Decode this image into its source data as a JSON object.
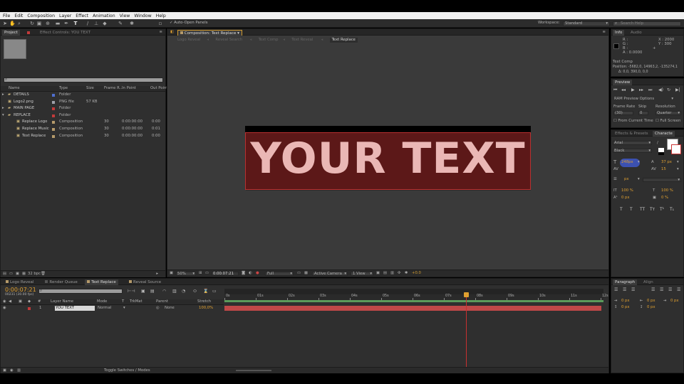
{
  "menu": [
    "File",
    "Edit",
    "Composition",
    "Layer",
    "Effect",
    "Animation",
    "View",
    "Window",
    "Help"
  ],
  "toolbar": {
    "auto_open": "Auto-Open Panels",
    "workspace_label": "Workspace:",
    "workspace_value": "Standard",
    "search_placeholder": "Search Help"
  },
  "project": {
    "tabs": [
      "Project",
      "Effect Controls: YOU TEXT"
    ],
    "columns": [
      "Name",
      "Type",
      "Size",
      "Frame R...",
      "In Point",
      "Out Point"
    ],
    "items": [
      {
        "name": "DETAILS",
        "type": "Folder",
        "size": "",
        "fr": "",
        "in": "",
        "out": "",
        "color": "#4f6fd0"
      },
      {
        "name": "Logo2.png",
        "type": "PNG file",
        "size": "57 KB",
        "fr": "",
        "in": "",
        "out": "",
        "color": "#9da0a8"
      },
      {
        "name": "MAIN PAGE",
        "type": "Folder",
        "size": "",
        "fr": "",
        "in": "",
        "out": "",
        "color": "#c23a3a"
      },
      {
        "name": "REPLACE",
        "type": "Folder",
        "size": "",
        "fr": "",
        "in": "",
        "out": "",
        "color": "#c23a3a"
      },
      {
        "name": "Replace Logo",
        "type": "Composition",
        "size": "",
        "fr": "30",
        "in": "0:00:00:00",
        "out": "0:00",
        "color": "#b59a6a"
      },
      {
        "name": "Replace Music",
        "type": "Composition",
        "size": "",
        "fr": "30",
        "in": "0:00:00:00",
        "out": "0:01",
        "color": "#b59a6a"
      },
      {
        "name": "Text Replace",
        "type": "Composition",
        "size": "",
        "fr": "30",
        "in": "0:00:00:00",
        "out": "0:00",
        "color": "#b59a6a"
      }
    ],
    "bpc": "32 bpc"
  },
  "composition": {
    "tab": "Composition: Text Replace",
    "flow_tabs": [
      "Logo Reveal",
      "Reveal Search",
      "Text Comp",
      "Text Reveal",
      "Text Replace"
    ],
    "canvas_text": "YOUR TEXT",
    "zoom": "50%",
    "timecode": "0:00:07:21",
    "quality": "Full",
    "camera": "Active Camera",
    "view": "1 View",
    "exposure": "+0.0"
  },
  "info": {
    "tabs": [
      "Info",
      "Audio"
    ],
    "r": "R :",
    "g": "G :",
    "b": "B :",
    "a": "A : 0.0000",
    "x": "X : 2000",
    "y": "Y : 300",
    "layer_name": "Text Comp",
    "position": "Position: -5682,0, 14963,2, -135274,1",
    "delta": "Δ: 0,0, 390,0, 0,0"
  },
  "preview": {
    "tab": "Preview",
    "ram": "RAM Preview Options",
    "frame_rate": "Frame Rate",
    "skip": "Skip",
    "resolution": "Resolution",
    "fr_val": "(30)",
    "skip_val": "0",
    "res_val": "Quarter",
    "from_current": "From Current Time",
    "full_screen": "Full Screen"
  },
  "character": {
    "tabs": [
      "Effects & Presets",
      "Characte"
    ],
    "font": "Arial",
    "style": "Black",
    "size": "248px",
    "leading": "37 px",
    "tracking": "15",
    "px1": "px",
    "vscale": "100 %",
    "hscale": "100 %",
    "baseline": "0 px",
    "tsume": "0 %",
    "style_buttons": [
      "T",
      "T",
      "TT",
      "Tт",
      "T¹",
      "T₁"
    ]
  },
  "paragraph": {
    "tabs": [
      "Paragraph",
      "Align"
    ],
    "fields": [
      "0 px",
      "0 px",
      "0 px",
      "0 px",
      "0 px"
    ]
  },
  "timeline": {
    "tabs": [
      "Logo Reveal",
      "Render Queue",
      "Text Replace",
      "Reveal Source"
    ],
    "timecode": "0:00:07:21",
    "frames": "00231 (30.00 fps)",
    "columns": [
      "#",
      "Layer Name",
      "Mode",
      "T",
      "TrkMat",
      "Parent",
      "Stretch"
    ],
    "layer": {
      "num": "1",
      "name": "YOU TEXT",
      "mode": "Normal",
      "parent": "None",
      "stretch": "100,0%"
    },
    "ruler": [
      "0s",
      "01s",
      "02s",
      "03s",
      "04s",
      "05s",
      "06s",
      "07s",
      "08s",
      "09s",
      "10s",
      "11s",
      "12s"
    ],
    "toggle": "Toggle Switches / Modes"
  }
}
